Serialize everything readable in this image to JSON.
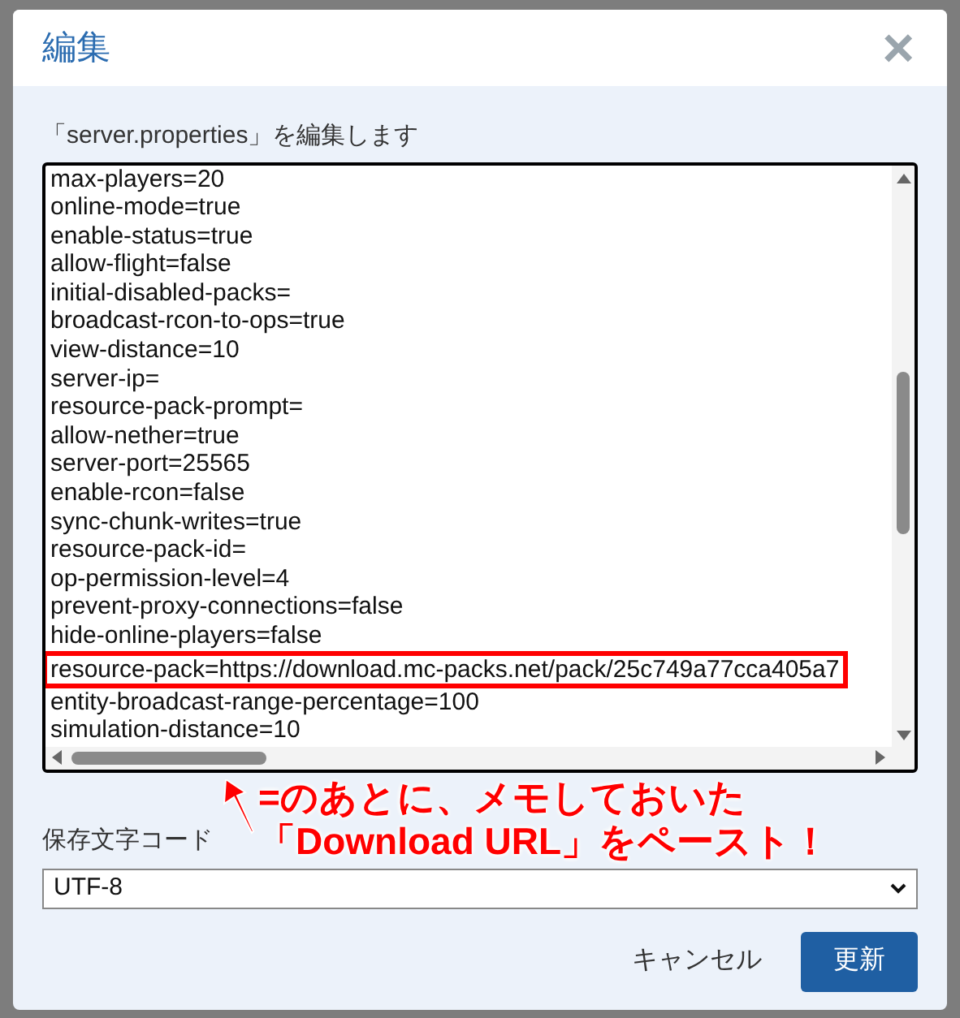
{
  "dialog": {
    "title": "編集",
    "close": "×"
  },
  "editor": {
    "label": "「server.properties」を編集します",
    "lines": [
      {
        "text": "max-players=20",
        "highlighted": false
      },
      {
        "text": "online-mode=true",
        "highlighted": false
      },
      {
        "text": "enable-status=true",
        "highlighted": false
      },
      {
        "text": "allow-flight=false",
        "highlighted": false
      },
      {
        "text": "initial-disabled-packs=",
        "highlighted": false
      },
      {
        "text": "broadcast-rcon-to-ops=true",
        "highlighted": false
      },
      {
        "text": "view-distance=10",
        "highlighted": false
      },
      {
        "text": "server-ip=",
        "highlighted": false
      },
      {
        "text": "resource-pack-prompt=",
        "highlighted": false
      },
      {
        "text": "allow-nether=true",
        "highlighted": false
      },
      {
        "text": "server-port=25565",
        "highlighted": false
      },
      {
        "text": "enable-rcon=false",
        "highlighted": false
      },
      {
        "text": "sync-chunk-writes=true",
        "highlighted": false
      },
      {
        "text": "resource-pack-id=",
        "highlighted": false
      },
      {
        "text": "op-permission-level=4",
        "highlighted": false
      },
      {
        "text": "prevent-proxy-connections=false",
        "highlighted": false
      },
      {
        "text": "hide-online-players=false",
        "highlighted": false
      },
      {
        "text": "resource-pack=https://download.mc-packs.net/pack/25c749a77cca405a7",
        "highlighted": true
      },
      {
        "text": "entity-broadcast-range-percentage=100",
        "highlighted": false
      },
      {
        "text": "simulation-distance=10",
        "highlighted": false
      }
    ]
  },
  "encoding": {
    "label": "保存文字コード",
    "value": "UTF-8"
  },
  "buttons": [
    {
      "label": "キャンセル",
      "kind": "secondary"
    },
    {
      "label": "更新",
      "kind": "primary"
    }
  ],
  "callout": {
    "lines": [
      "=のあとに、メモしておいた",
      "「Download URL」をペースト！"
    ]
  }
}
